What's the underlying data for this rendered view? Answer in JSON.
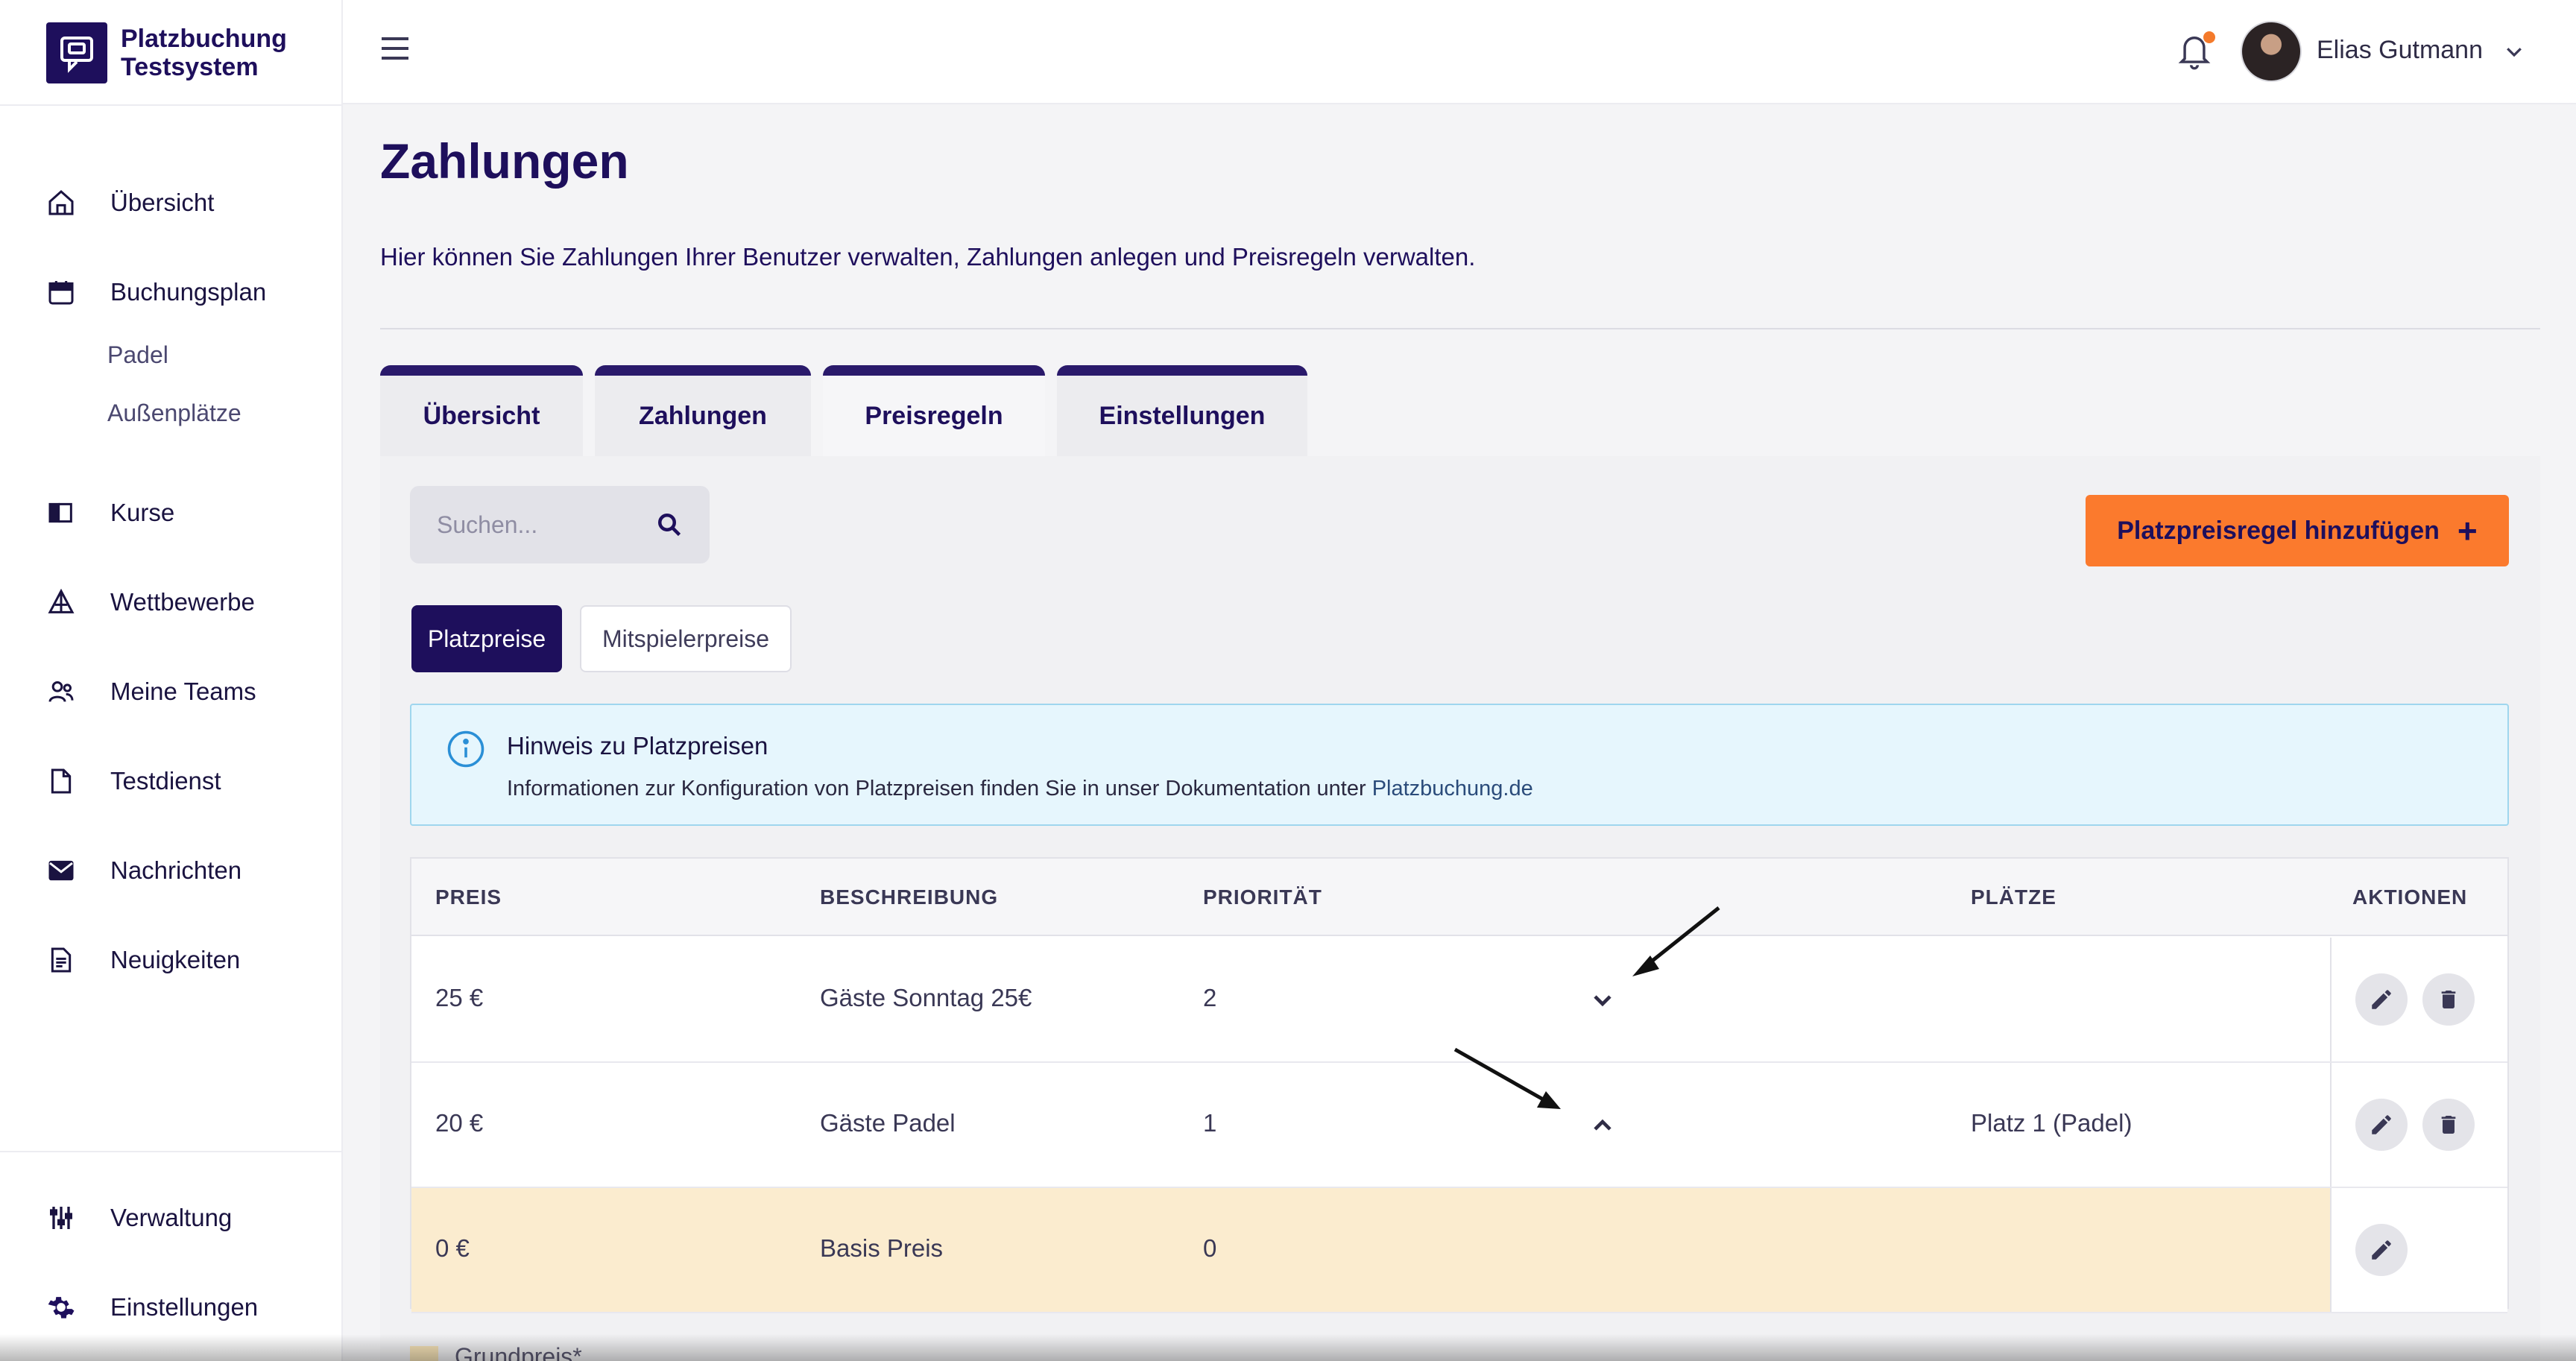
{
  "brand": {
    "line1": "Platzbuchung",
    "line2": "Testsystem"
  },
  "sidebar": {
    "items": [
      {
        "label": "Übersicht",
        "icon": "home-icon"
      },
      {
        "label": "Buchungsplan",
        "icon": "calendar-icon"
      },
      {
        "label": "Kurse",
        "icon": "book-icon"
      },
      {
        "label": "Wettbewerbe",
        "icon": "trophy-icon"
      },
      {
        "label": "Meine Teams",
        "icon": "users-icon"
      },
      {
        "label": "Testdienst",
        "icon": "document-icon"
      },
      {
        "label": "Nachrichten",
        "icon": "mail-icon"
      },
      {
        "label": "Neuigkeiten",
        "icon": "news-icon"
      }
    ],
    "sub_items": [
      "Padel",
      "Außenplätze"
    ],
    "bottom_items": [
      {
        "label": "Verwaltung",
        "icon": "sliders-icon"
      },
      {
        "label": "Einstellungen",
        "icon": "gear-icon"
      }
    ]
  },
  "topbar": {
    "user_name": "Elias Gutmann"
  },
  "page": {
    "title": "Zahlungen",
    "description": "Hier können Sie Zahlungen Ihrer Benutzer verwalten, Zahlungen anlegen und Preisregeln verwalten."
  },
  "tabs": [
    "Übersicht",
    "Zahlungen",
    "Preisregeln",
    "Einstellungen"
  ],
  "search": {
    "placeholder": "Suchen..."
  },
  "add_button": {
    "label": "Platzpreisregel hinzufügen",
    "icon": "plus-icon"
  },
  "filters": [
    "Platzpreise",
    "Mitspielerpreise"
  ],
  "notice": {
    "title": "Hinweis zu Platzpreisen",
    "text": "Informationen zur Konfiguration von Platzpreisen finden Sie in unser Dokumentation unter ",
    "link": "Platzbuchung.de"
  },
  "table": {
    "headers": [
      "PREIS",
      "BESCHREIBUNG",
      "PRIORITÄT",
      "PLÄTZE",
      "AKTIONEN"
    ],
    "rows": [
      {
        "preis": "25 €",
        "beschreibung": "Gäste Sonntag 25€",
        "prioritaet": "2",
        "plaetze": ""
      },
      {
        "preis": "20 €",
        "beschreibung": "Gäste Padel",
        "prioritaet": "1",
        "plaetze": "Platz 1 (Padel)"
      },
      {
        "preis": "0 €",
        "beschreibung": "Basis Preis",
        "prioritaet": "0",
        "plaetze": ""
      }
    ]
  },
  "legend": {
    "label": "Grundpreis*"
  },
  "colors": {
    "brand": "#1e0f5c",
    "accent": "#fb7a2d",
    "notice_bg": "#e6f6fd",
    "base_row": "#fbeccf"
  }
}
